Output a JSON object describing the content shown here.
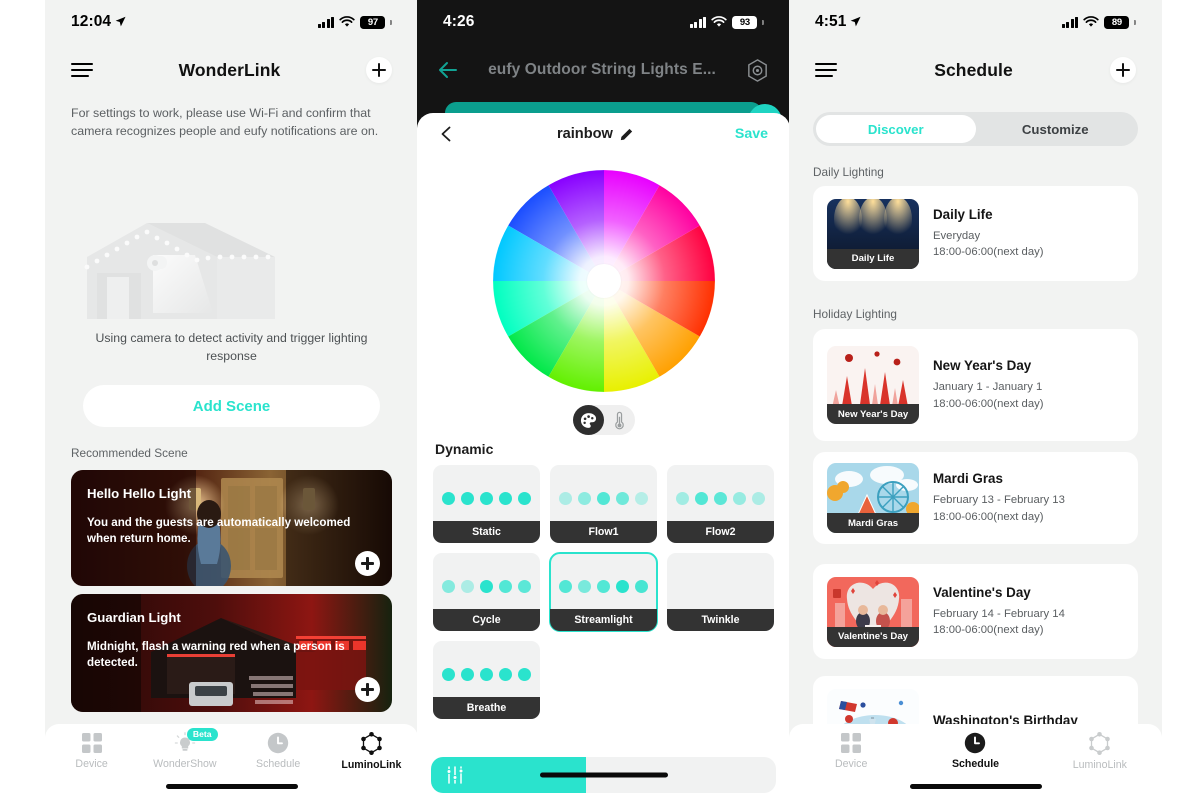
{
  "panel1": {
    "status": {
      "time": "12:04",
      "battery": "97",
      "location_icon": "location-arrow-icon",
      "signal_icon": "cellular-bars-icon",
      "wifi_icon": "wifi-icon"
    },
    "nav": {
      "menu_icon": "hamburger-menu-icon",
      "title": "WonderLink",
      "add_icon": "plus-icon"
    },
    "hint": "For settings to work, please use Wi-Fi and confirm that camera recognizes people and eufy notifications are on.",
    "illustration": "house-string-lights-camera-illustration",
    "caption": "Using camera to detect activity and trigger lighting response",
    "add_scene_label": "Add Scene",
    "section_label": "Recommended Scene",
    "scenes": [
      {
        "title": "Hello Hello Light",
        "desc": "You and the guests are automatically welcomed when return home.",
        "add_icon": "plus-circle-icon"
      },
      {
        "title": "Guardian Light",
        "desc": "Midnight, flash a warning red when a person is detected.",
        "add_icon": "plus-circle-icon"
      }
    ],
    "tabs": [
      {
        "label": "Device",
        "icon": "grid-squares-icon",
        "active": false,
        "badge": ""
      },
      {
        "label": "WonderShow",
        "icon": "lightbulb-icon",
        "active": false,
        "badge": "Beta"
      },
      {
        "label": "Schedule",
        "icon": "clock-icon",
        "active": false,
        "badge": ""
      },
      {
        "label": "LuminoLink",
        "icon": "hexagon-nodes-icon",
        "active": true,
        "badge": ""
      }
    ]
  },
  "panel2": {
    "status": {
      "time": "4:26",
      "battery": "93",
      "signal_icon": "cellular-bars-icon",
      "wifi_icon": "wifi-icon"
    },
    "nav": {
      "back_icon": "arrow-left-icon",
      "title": "eufy Outdoor String Lights E...",
      "settings_icon": "hexagon-target-icon"
    },
    "sheet": {
      "back_icon": "chevron-left-icon",
      "title": "rainbow",
      "edit_icon": "pencil-icon",
      "save_label": "Save",
      "color_wheel": "hsv-color-wheel",
      "mode_toggle": {
        "palette_icon": "color-palette-icon",
        "temperature_icon": "thermometer-icon",
        "selected": "palette"
      },
      "dynamic_label": "Dynamic",
      "effects": [
        {
          "name": "Static",
          "selected": false,
          "dots": [
            1,
            1,
            1,
            1,
            1
          ]
        },
        {
          "name": "Flow1",
          "selected": false,
          "dots": [
            0.35,
            0.5,
            0.8,
            0.65,
            0.3
          ]
        },
        {
          "name": "Flow2",
          "selected": false,
          "dots": [
            0.4,
            0.8,
            0.75,
            0.45,
            0.35
          ]
        },
        {
          "name": "Cycle",
          "selected": false,
          "dots": [
            0.55,
            0.35,
            1,
            0.8,
            0.75
          ]
        },
        {
          "name": "Streamlight",
          "selected": true,
          "dots": [
            0.8,
            0.6,
            0.8,
            1,
            0.85
          ]
        },
        {
          "name": "Twinkle",
          "selected": false,
          "dots": []
        },
        {
          "name": "Breathe",
          "selected": false,
          "dots": [
            1,
            1,
            1,
            1,
            1
          ]
        }
      ],
      "bottom_slider": {
        "icon": "sliders-icon",
        "fill_percent": 45
      }
    },
    "accent": "#2ae3cd"
  },
  "panel3": {
    "status": {
      "time": "4:51",
      "battery": "89",
      "location_icon": "location-arrow-icon",
      "signal_icon": "cellular-bars-icon",
      "wifi_icon": "wifi-icon"
    },
    "nav": {
      "menu_icon": "hamburger-menu-icon",
      "title": "Schedule",
      "add_icon": "plus-icon"
    },
    "segments": [
      {
        "label": "Discover",
        "active": true
      },
      {
        "label": "Customize",
        "active": false
      }
    ],
    "sections": [
      {
        "label": "Daily Lighting"
      },
      {
        "label": "Holiday Lighting"
      }
    ],
    "schedules": [
      {
        "title": "Daily Life",
        "thumb_caption": "Daily Life",
        "range": "Everyday",
        "time": "18:00-06:00(next day)",
        "thumb": "warm-lights-night"
      },
      {
        "title": "New Year's Day",
        "thumb_caption": "New Year's Day",
        "range": "January 1 - January 1",
        "time": "18:00-06:00(next day)",
        "thumb": "red-city-winter"
      },
      {
        "title": "Mardi Gras",
        "thumb_caption": "Mardi Gras",
        "range": "February 13 - February 13",
        "time": "18:00-06:00(next day)",
        "thumb": "carnival-ferris-wheel"
      },
      {
        "title": "Valentine's Day",
        "thumb_caption": "Valentine's Day",
        "range": "February 14 - February 14",
        "time": "18:00-06:00(next day)",
        "thumb": "valentine-couple-hearts"
      },
      {
        "title": "Washington's Birthday",
        "thumb_caption": "",
        "range": "",
        "time": "",
        "thumb": "usa-flag-balloons"
      }
    ],
    "tabs": [
      {
        "label": "Device",
        "icon": "grid-squares-icon",
        "active": false
      },
      {
        "label": "Schedule",
        "icon": "clock-icon",
        "active": true
      },
      {
        "label": "LuminoLink",
        "icon": "hexagon-nodes-icon",
        "active": false
      }
    ]
  }
}
